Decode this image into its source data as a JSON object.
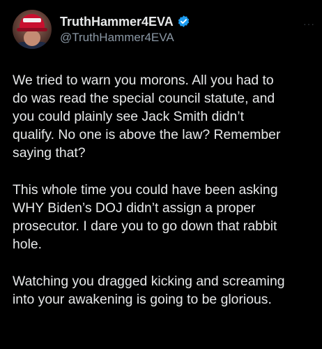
{
  "post": {
    "display_name": "TruthHammer4EVA",
    "handle": "@TruthHammer4EVA",
    "verified": true,
    "accent_color": "#1d9bf0",
    "paragraphs": [
      "We tried to warn you morons. All you had to\ndo was read the special council statute, and\nyou could plainly see Jack Smith didn’t\nqualify. No one is above the law? Remember\nsaying that?",
      "This whole time you could have been asking\nWHY Biden’s DOJ didn’t assign a proper\nprosecutor. I dare you to go down that rabbit\nhole.",
      "Watching you dragged kicking and screaming\ninto your awakening is going to be glorious."
    ],
    "more_icon": "ellipsis-icon"
  }
}
